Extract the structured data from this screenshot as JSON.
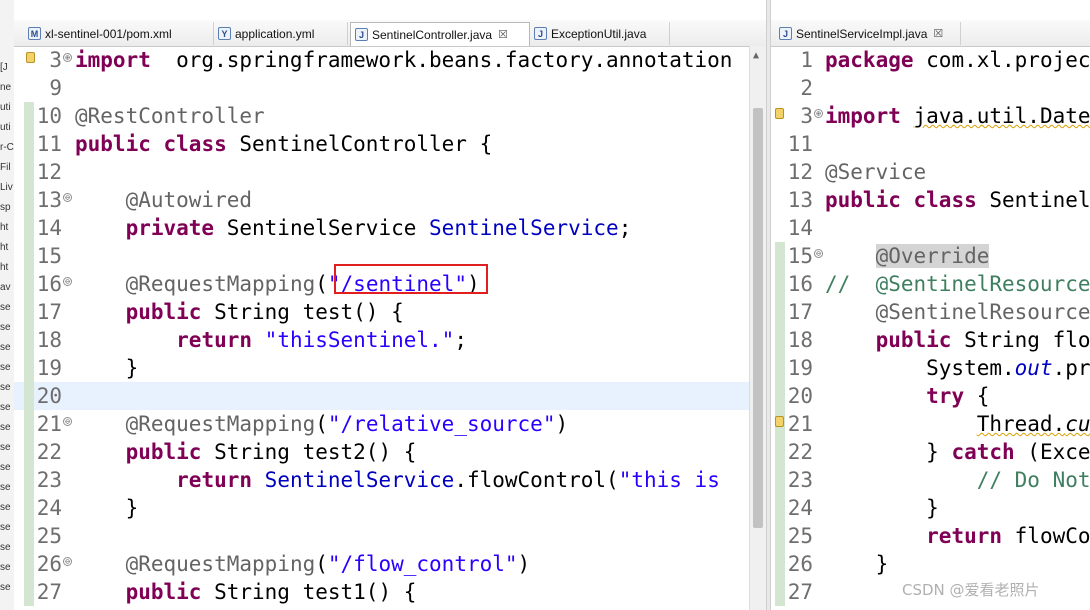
{
  "left_strip": [
    "[J",
    "ne",
    "uti",
    "uti",
    "r-C",
    "Fil",
    "Liv",
    "sp",
    "ht",
    "ht",
    "ht",
    "av",
    "se",
    "se",
    "se",
    "se",
    "se",
    "se",
    "se",
    "se",
    "se",
    "se",
    "se",
    "se",
    "se",
    "se",
    "se"
  ],
  "left_tabs": [
    {
      "label": "xl-sentinel-001/pom.xml",
      "icon": "maven-pom-icon",
      "icon_glyph": "M",
      "active": false
    },
    {
      "label": "application.yml",
      "icon": "yaml-file-icon",
      "icon_glyph": "Y",
      "active": false
    },
    {
      "label": "SentinelController.java",
      "icon": "java-file-icon",
      "icon_glyph": "J",
      "active": true,
      "close_glyph": "☒"
    },
    {
      "label": "ExceptionUtil.java",
      "icon": "java-file-icon",
      "icon_glyph": "J",
      "active": false
    }
  ],
  "right_tabs": [
    {
      "label": "SentinelServiceImpl.java",
      "icon": "java-file-icon",
      "icon_glyph": "J",
      "active": false,
      "close_glyph": "☒"
    }
  ],
  "left_editor": {
    "lines": [
      {
        "num": "3",
        "fold": "⊕",
        "warn": true,
        "mod": false,
        "tokens": [
          [
            "kw",
            "import"
          ],
          [
            "",
            "  org.springframework.beans.factory.annotation"
          ]
        ]
      },
      {
        "num": "9",
        "tokens": []
      },
      {
        "num": "10",
        "mod": true,
        "tokens": [
          [
            "ann",
            "@RestController"
          ]
        ]
      },
      {
        "num": "11",
        "mod": true,
        "tokens": [
          [
            "kw",
            "public"
          ],
          [
            "",
            " "
          ],
          [
            "kw",
            "class"
          ],
          [
            "",
            " SentinelController {"
          ]
        ]
      },
      {
        "num": "12",
        "mod": true,
        "tokens": []
      },
      {
        "num": "13",
        "fold": "⊖",
        "mod": true,
        "tokens": [
          [
            "",
            "    "
          ],
          [
            "ann",
            "@Autowired"
          ]
        ]
      },
      {
        "num": "14",
        "mod": true,
        "tokens": [
          [
            "",
            "    "
          ],
          [
            "kw",
            "private"
          ],
          [
            "",
            " SentinelService "
          ],
          [
            "fld",
            "SentinelService"
          ],
          [
            "",
            ";"
          ]
        ]
      },
      {
        "num": "15",
        "mod": true,
        "tokens": []
      },
      {
        "num": "16",
        "fold": "⊖",
        "mod": true,
        "tokens": [
          [
            "",
            "    "
          ],
          [
            "ann",
            "@RequestMapping"
          ],
          [
            "",
            "("
          ],
          [
            "str",
            "\"/sentinel\""
          ],
          [
            "",
            ")"
          ]
        ]
      },
      {
        "num": "17",
        "mod": true,
        "tokens": [
          [
            "",
            "    "
          ],
          [
            "kw",
            "public"
          ],
          [
            "",
            " String test() {"
          ]
        ]
      },
      {
        "num": "18",
        "mod": true,
        "tokens": [
          [
            "",
            "        "
          ],
          [
            "kw",
            "return"
          ],
          [
            "",
            " "
          ],
          [
            "str",
            "\"thisSentinel.\""
          ],
          [
            "",
            ";"
          ]
        ]
      },
      {
        "num": "19",
        "mod": true,
        "tokens": [
          [
            "",
            "    }"
          ]
        ]
      },
      {
        "num": "20",
        "mod": true,
        "current": true,
        "tokens": []
      },
      {
        "num": "21",
        "fold": "⊖",
        "mod": true,
        "tokens": [
          [
            "",
            "    "
          ],
          [
            "ann",
            "@RequestMapping"
          ],
          [
            "",
            "("
          ],
          [
            "str",
            "\"/relative_source\""
          ],
          [
            "",
            ")"
          ]
        ]
      },
      {
        "num": "22",
        "mod": true,
        "tokens": [
          [
            "",
            "    "
          ],
          [
            "kw",
            "public"
          ],
          [
            "",
            " String test2() {"
          ]
        ]
      },
      {
        "num": "23",
        "mod": true,
        "tokens": [
          [
            "",
            "        "
          ],
          [
            "kw",
            "return"
          ],
          [
            "",
            " "
          ],
          [
            "fld",
            "SentinelService"
          ],
          [
            "",
            ".flowControl("
          ],
          [
            "str",
            "\"this is"
          ]
        ]
      },
      {
        "num": "24",
        "mod": true,
        "tokens": [
          [
            "",
            "    }"
          ]
        ]
      },
      {
        "num": "25",
        "mod": true,
        "tokens": []
      },
      {
        "num": "26",
        "fold": "⊖",
        "mod": true,
        "tokens": [
          [
            "",
            "    "
          ],
          [
            "ann",
            "@RequestMapping"
          ],
          [
            "",
            "("
          ],
          [
            "str",
            "\"/flow_control\""
          ],
          [
            "",
            ")"
          ]
        ]
      },
      {
        "num": "27",
        "mod": true,
        "tokens": [
          [
            "",
            "    "
          ],
          [
            "kw",
            "public"
          ],
          [
            "",
            " String test1() {"
          ]
        ]
      }
    ]
  },
  "right_editor": {
    "lines": [
      {
        "num": "1",
        "tokens": [
          [
            "kw",
            "package"
          ],
          [
            "",
            " com.xl.projec"
          ]
        ]
      },
      {
        "num": "2",
        "tokens": []
      },
      {
        "num": "3",
        "fold": "⊕",
        "warn": true,
        "tokens": [
          [
            "kw",
            "import"
          ],
          [
            "",
            " "
          ],
          [
            "squig",
            "java.util.Date"
          ]
        ]
      },
      {
        "num": "11",
        "tokens": []
      },
      {
        "num": "12",
        "tokens": [
          [
            "ann",
            "@Service"
          ]
        ]
      },
      {
        "num": "13",
        "tokens": [
          [
            "kw",
            "public"
          ],
          [
            "",
            " "
          ],
          [
            "kw",
            "class"
          ],
          [
            "",
            " Sentinel"
          ]
        ]
      },
      {
        "num": "14",
        "tokens": []
      },
      {
        "num": "15",
        "fold": "⊖",
        "mod": true,
        "tokens": [
          [
            "",
            "    "
          ],
          [
            "ann hl",
            "@Override"
          ]
        ]
      },
      {
        "num": "16",
        "mod": true,
        "tokens": [
          [
            "cmt",
            "//  @SentinelResource"
          ]
        ]
      },
      {
        "num": "17",
        "mod": true,
        "tokens": [
          [
            "",
            "    "
          ],
          [
            "ann",
            "@SentinelResource"
          ]
        ]
      },
      {
        "num": "18",
        "mod": true,
        "tokens": [
          [
            "",
            "    "
          ],
          [
            "kw",
            "public"
          ],
          [
            "",
            " String flo"
          ]
        ]
      },
      {
        "num": "19",
        "mod": true,
        "tokens": [
          [
            "",
            "        System."
          ],
          [
            "fld ital",
            "out"
          ],
          [
            "",
            ".pr"
          ]
        ]
      },
      {
        "num": "20",
        "mod": true,
        "tokens": [
          [
            "",
            "        "
          ],
          [
            "kw",
            "try"
          ],
          [
            "",
            " {"
          ]
        ]
      },
      {
        "num": "21",
        "warn": true,
        "mod": true,
        "tokens": [
          [
            "",
            "            "
          ],
          [
            "squig",
            "Thread."
          ],
          [
            "ital squig",
            "cu"
          ]
        ]
      },
      {
        "num": "22",
        "mod": true,
        "tokens": [
          [
            "",
            "        } "
          ],
          [
            "kw",
            "catch"
          ],
          [
            "",
            " (Exce"
          ]
        ]
      },
      {
        "num": "23",
        "mod": true,
        "tokens": [
          [
            "",
            "            "
          ],
          [
            "cmt",
            "// Do Not"
          ]
        ]
      },
      {
        "num": "24",
        "mod": true,
        "tokens": [
          [
            "",
            "        }"
          ]
        ]
      },
      {
        "num": "25",
        "mod": true,
        "tokens": [
          [
            "",
            "        "
          ],
          [
            "kw",
            "return"
          ],
          [
            "",
            " flowCo"
          ]
        ]
      },
      {
        "num": "26",
        "mod": true,
        "tokens": [
          [
            "",
            "    }"
          ]
        ]
      },
      {
        "num": "27",
        "mod": true,
        "tokens": []
      }
    ]
  },
  "watermark": "CSDN @爱看老照片"
}
